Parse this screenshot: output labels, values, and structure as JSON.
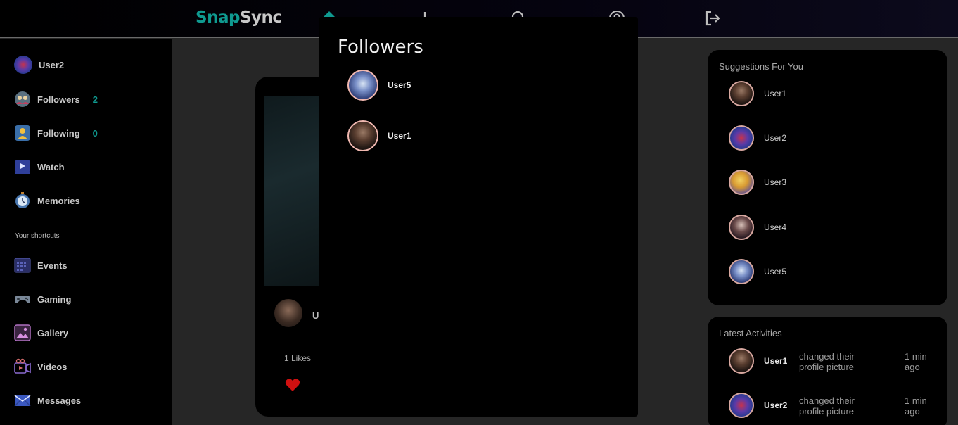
{
  "header": {
    "logo_part1": "Snap",
    "logo_part2": "Sync",
    "nav_icons": [
      "home-icon",
      "add-icon",
      "search-icon",
      "location-icon",
      "logout-icon"
    ]
  },
  "sidebar": {
    "user": {
      "name": "User2"
    },
    "items": [
      {
        "label": "Followers",
        "count": "2",
        "icon": "followers-icon"
      },
      {
        "label": "Following",
        "count": "0",
        "icon": "following-icon"
      },
      {
        "label": "Watch",
        "icon": "watch-icon"
      },
      {
        "label": "Memories",
        "icon": "memories-icon"
      }
    ],
    "shortcuts_label": "Your shortcuts",
    "shortcuts": [
      {
        "label": "Events",
        "icon": "calendar-icon"
      },
      {
        "label": "Gaming",
        "icon": "gamepad-icon"
      },
      {
        "label": "Gallery",
        "icon": "gallery-icon"
      },
      {
        "label": "Videos",
        "icon": "video-camera-icon"
      },
      {
        "label": "Messages",
        "icon": "envelope-icon"
      }
    ]
  },
  "post": {
    "user": "U",
    "likes": "1 Likes",
    "heart_color": "#d01010"
  },
  "followers_modal": {
    "title": "Followers",
    "followers": [
      {
        "name": "User5"
      },
      {
        "name": "User1"
      }
    ]
  },
  "suggestions": {
    "title": "Suggestions For You",
    "users": [
      {
        "name": "User1"
      },
      {
        "name": "User2"
      },
      {
        "name": "User3"
      },
      {
        "name": "User4"
      },
      {
        "name": "User5"
      }
    ]
  },
  "activities": {
    "title": "Latest Activities",
    "items": [
      {
        "user": "User1",
        "text": "changed their profile picture",
        "time": "1 min ago"
      },
      {
        "user": "User2",
        "text": "changed their profile picture",
        "time": "1 min ago"
      }
    ]
  },
  "colors": {
    "accent": "#0f9a90",
    "background": "#262626",
    "panel": "#000000"
  }
}
